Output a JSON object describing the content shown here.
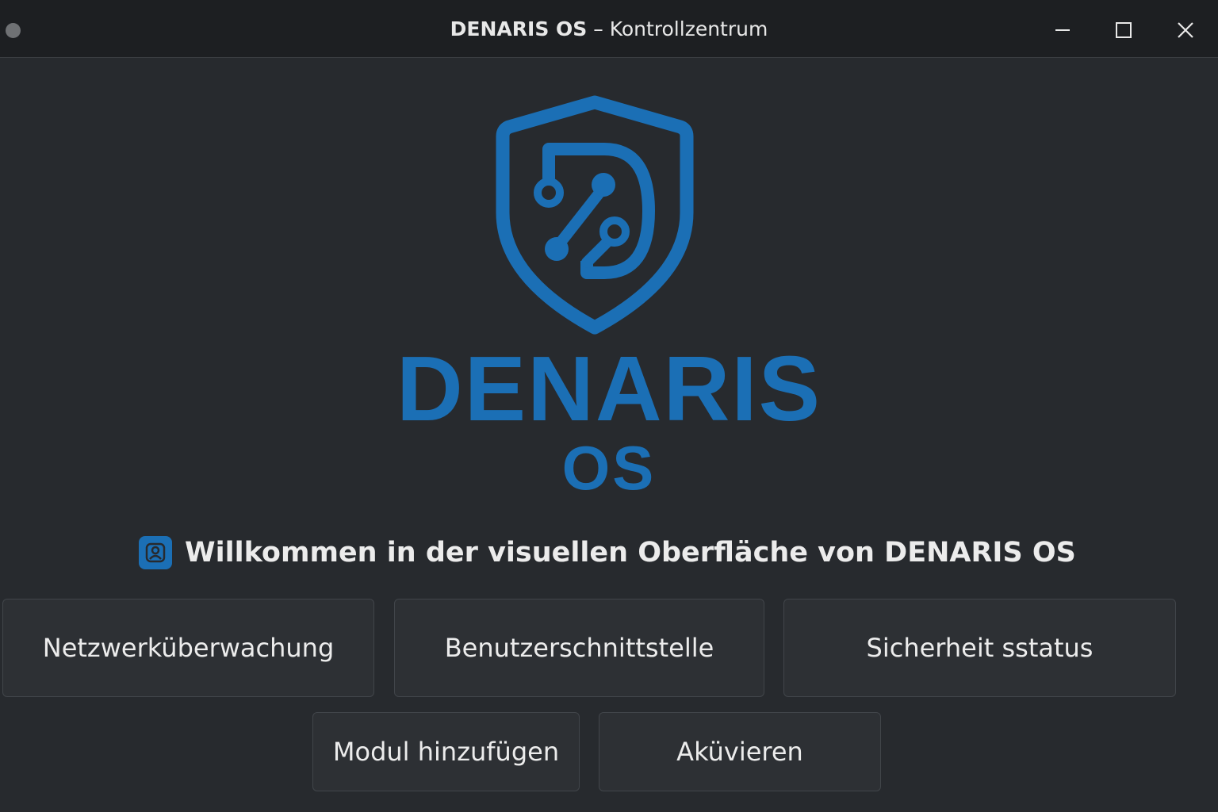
{
  "window": {
    "title_bold": "DENARIS OS",
    "title_rest": " – Kontrollzentrum",
    "controls": {
      "minimize_icon": "minimize-icon",
      "maximize_icon": "maximize-icon",
      "close_icon": "close-icon"
    }
  },
  "brand": {
    "logo_icon": "shield-circuit-logo-icon",
    "name": "DENARIS",
    "sub": "OS",
    "color": "#1b6fb5"
  },
  "welcome": {
    "icon": "user-lock-icon",
    "text": "Willkommen in der visuellen Oberfläche von DENARIS OS"
  },
  "buttons": {
    "row1": [
      {
        "label": "Netzwerküberwachung"
      },
      {
        "label": "Benutzerschnittstelle"
      },
      {
        "label": "Sicherheit sstatus"
      }
    ],
    "row2": [
      {
        "label": "Modul hinzufügen"
      },
      {
        "label": "Aküvieren"
      }
    ]
  },
  "colors": {
    "background": "#272a2e",
    "titlebar": "#1d1f22",
    "button": "#2d3034",
    "accent": "#1b6fb5"
  }
}
